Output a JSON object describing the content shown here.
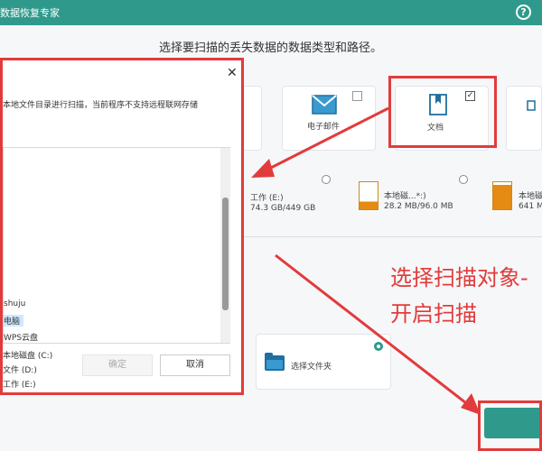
{
  "window": {
    "title": "数据恢复专家",
    "help_glyph": "?"
  },
  "heading": "选择要扫描的丢失数据的数据类型和路径。",
  "file_types": [
    {
      "label": "电子邮件",
      "checked": false,
      "icon": "envelope-icon"
    },
    {
      "label": "文档",
      "checked": true,
      "check_mark": "✓",
      "icon": "document-bookmark-icon"
    }
  ],
  "drives": [
    {
      "name": "工作 (E:)",
      "usage": "74.3 GB/449 GB",
      "used_fraction": 0.17
    },
    {
      "name": "本地磁...*:)",
      "usage": "28.2 MB/96.0 MB",
      "used_fraction": 0.29
    },
    {
      "name": "本地磁",
      "usage": "641 M",
      "used_fraction": 0.9
    }
  ],
  "folder_option": {
    "label": "选择文件夹",
    "selected": true
  },
  "annotation": {
    "line1": "选择扫描对象-",
    "line2": "开启扫描"
  },
  "dialog": {
    "description": "本地文件目录进行扫描，当前程序不支持远程联网存储",
    "close_glyph": "✕",
    "tree_items": [
      "shuju",
      "电脑",
      "WPS云盘",
      "本地磁盘 (C:)",
      "文件 (D:)",
      "工作 (E:)"
    ],
    "selected_index": 1,
    "confirm_label": "确定",
    "cancel_label": "取消"
  },
  "colors": {
    "accent": "#2f9a8c",
    "annotation_red": "#e23b3b",
    "drive_fill": "#e58a13"
  }
}
